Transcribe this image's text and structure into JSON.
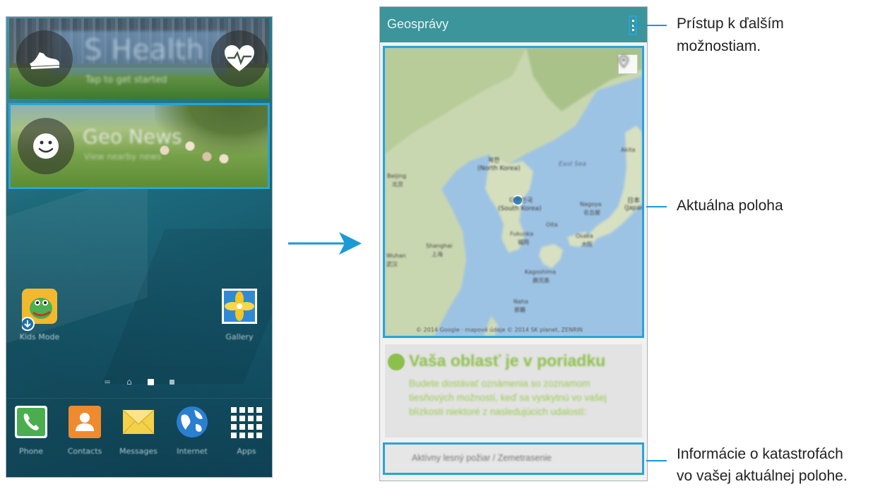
{
  "colors": {
    "callout_blue": "#1a9ad6",
    "highlight_blue": "#2aa3d8",
    "app_bar": "#3b959a",
    "status_green": "#8cc04a"
  },
  "home_screen": {
    "health_widget": {
      "title": "S Health",
      "subtitle": "Tap to get started",
      "left_icon": "running-shoe-icon",
      "right_icon": "heart-pulse-icon"
    },
    "geo_widget": {
      "title": "Geo News",
      "subtitle": "View nearby news",
      "icon": "smiley-icon"
    },
    "apps": [
      {
        "label": "Kids Mode",
        "icon": "kids-mode-icon"
      },
      {
        "label": "Gallery",
        "icon": "gallery-icon"
      }
    ],
    "dock": [
      {
        "label": "Phone",
        "icon": "phone-icon"
      },
      {
        "label": "Contacts",
        "icon": "contacts-icon"
      },
      {
        "label": "Messages",
        "icon": "messages-icon"
      },
      {
        "label": "Internet",
        "icon": "internet-globe-icon"
      },
      {
        "label": "Apps",
        "icon": "apps-grid-icon"
      }
    ],
    "page_indicator": {
      "first_glyph": "=",
      "home_glyph": "⌂"
    }
  },
  "geo_app": {
    "title": "Geosprávy",
    "map": {
      "labels": {
        "north_korea": "북한",
        "north_korea_en": "(North Korea)",
        "south_korea": "대한민국",
        "south_korea_en": "(South Korea)",
        "east_sea": "East Sea",
        "beijing": "Beijing",
        "beijing_cn": "北京",
        "shanghai": "Shanghai",
        "shanghai_cn": "上海",
        "wuhan": "Wuhan",
        "wuhan_cn": "武汉",
        "fukuoka": "Fukuoka",
        "fukuoka_jp": "福岡",
        "osaka": "Osaka",
        "osaka_jp": "大阪",
        "nagoya": "Nagoya",
        "nagoya_jp": "名古屋",
        "japan": "日本",
        "japan_en": "(Japan)",
        "kagoshima": "Kagoshima",
        "kagoshima_jp": "鹿児島",
        "naha": "Naha",
        "naha_jp": "那覇",
        "akita": "Akita",
        "oita": "Oita"
      },
      "copyright": "© 2014 Google · mapové údaje © 2014 SK planet, ZENRIN"
    },
    "status": {
      "title": "Vaša oblasť je v poriadku",
      "body": "Budete dostávať oznámenia so zoznamom tiesňových možností, keď sa vyskytnú vo vašej blízkosti niektoré z nasledujúcich udalostí:"
    },
    "events": "Aktívny lesný požiar / Zemetrasenie"
  },
  "callouts": {
    "more_options_line1": "Prístup k ďalším",
    "more_options_line2": "možnostiam.",
    "location": "Aktuálna poloha",
    "disasters_line1": "Informácie o katastrofách",
    "disasters_line2": "vo vašej aktuálnej polohe."
  }
}
